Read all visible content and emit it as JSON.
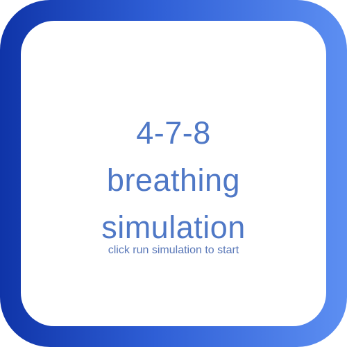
{
  "title_lines": [
    "4-7-8",
    "breathing",
    "simulation"
  ],
  "hint": "click run simulation to start",
  "colors": {
    "frame_gradient_start": "#0f34a8",
    "frame_gradient_end": "#5d8ff2",
    "title_text": "#4f78c6",
    "hint_text": "#5a78b8",
    "card_bg": "#ffffff"
  }
}
